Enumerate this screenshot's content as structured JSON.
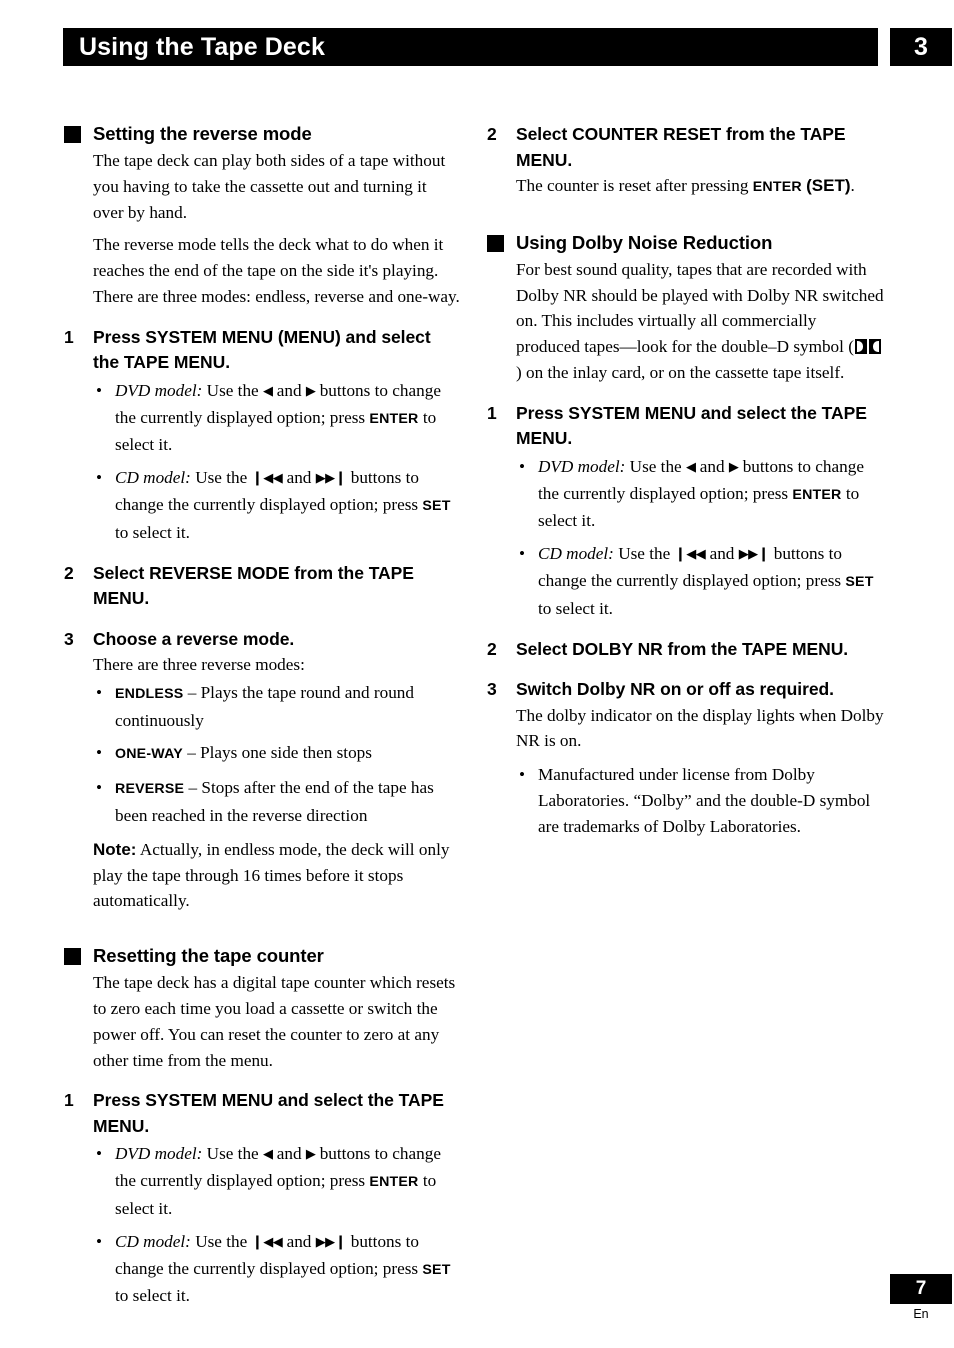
{
  "header": {
    "title": "Using the Tape Deck",
    "chapter": "3"
  },
  "footer": {
    "page_number": "7",
    "language": "En"
  },
  "left_column": {
    "section1": {
      "heading": "Setting the reverse mode",
      "intro_p1": "The tape deck can play both sides of a tape without you having to take the cassette out and turning it over by hand.",
      "intro_p2": "The reverse mode tells the deck what to do when it reaches the end of the tape on the side it's playing. There are three modes: endless, reverse and  one-way.",
      "step1": {
        "num": "1",
        "title": "Press SYSTEM MENU (MENU) and select the TAPE MENU.",
        "dvd_label": "DVD model:",
        "dvd_text_a": "Use the",
        "dvd_text_b": "and",
        "dvd_text_c": "buttons to change the currently displayed option; press",
        "dvd_key": "ENTER",
        "dvd_text_d": "to select it.",
        "cd_label": "CD model:",
        "cd_text_a": "Use the",
        "cd_text_b": "and",
        "cd_text_c": "buttons to change the currently displayed option; press",
        "cd_key": "SET",
        "cd_text_d": "to select it."
      },
      "step2": {
        "num": "2",
        "title": "Select REVERSE MODE from the TAPE MENU."
      },
      "step3": {
        "num": "3",
        "title": "Choose a reverse mode.",
        "body": "There are three reverse modes:",
        "modes": [
          {
            "name": "ENDLESS",
            "desc": "– Plays the tape round and round continuously"
          },
          {
            "name": "ONE-WAY",
            "desc": "– Plays one side then stops"
          },
          {
            "name": "REVERSE",
            "desc": "– Stops after the end of the tape has been reached in the reverse direction"
          }
        ],
        "note_label": "Note:",
        "note_text": "Actually, in endless mode, the deck will only play the tape through 16 times before it stops automatically."
      }
    },
    "section2": {
      "heading": "Resetting the tape counter",
      "intro": "The tape deck has a digital tape counter which resets to zero each time you load a cassette or switch the power off. You can reset the counter to zero at any other time from the menu.",
      "step1": {
        "num": "1",
        "title": "Press SYSTEM MENU and select the TAPE MENU.",
        "dvd_label": "DVD model:",
        "dvd_text_a": "Use the",
        "dvd_text_b": "and",
        "dvd_text_c": "buttons to change the currently displayed option; press",
        "dvd_key": "ENTER",
        "dvd_text_d": "to select it.",
        "cd_label": "CD model:",
        "cd_text_a": "Use the",
        "cd_text_b": "and",
        "cd_text_c": "buttons to change the currently displayed option; press",
        "cd_key": "SET",
        "cd_text_d": "to select it."
      }
    }
  },
  "right_column": {
    "section2_cont": {
      "step2": {
        "num": "2",
        "title": "Select COUNTER RESET from the TAPE MENU.",
        "body_a": "The counter is reset after pressing",
        "body_key1": "ENTER",
        "body_key2": "(SET)",
        "body_b": "."
      }
    },
    "section3": {
      "heading": "Using Dolby Noise Reduction",
      "intro_a": "For best sound quality, tapes that are recorded with Dolby NR should be played with Dolby NR switched on. This includes virtually all commercially produced tapes—look for the double–D symbol (",
      "intro_b": ") on the inlay card, or on the cassette tape itself.",
      "step1": {
        "num": "1",
        "title": "Press SYSTEM MENU and select the TAPE MENU.",
        "dvd_label": "DVD model:",
        "dvd_text_a": "Use the",
        "dvd_text_b": "and",
        "dvd_text_c": "buttons to change the currently displayed option; press",
        "dvd_key": "ENTER",
        "dvd_text_d": "to select it.",
        "cd_label": "CD model:",
        "cd_text_a": "Use the",
        "cd_text_b": "and",
        "cd_text_c": "buttons to change the currently displayed option; press",
        "cd_key": "SET",
        "cd_text_d": "to select it."
      },
      "step2": {
        "num": "2",
        "title": "Select DOLBY NR from the TAPE MENU."
      },
      "step3": {
        "num": "3",
        "title": "Switch Dolby NR on or off as required.",
        "body": "The dolby indicator on the display lights when Dolby NR is on.",
        "trademark": "Manufactured under license from Dolby Laboratories. “Dolby” and the double-D symbol are trademarks of Dolby Laboratories."
      }
    }
  },
  "glyphs": {
    "left_arrow": "◀",
    "right_arrow": "▶",
    "skip_back": "◀◀",
    "skip_fwd": "▶▶",
    "bar_left": "❙",
    "bar_right": "❙",
    "bullet": "•"
  },
  "colors": {
    "page_background": "#ffffff",
    "ink": "#000000",
    "header_bar": "#000000",
    "header_text": "#ffffff"
  }
}
